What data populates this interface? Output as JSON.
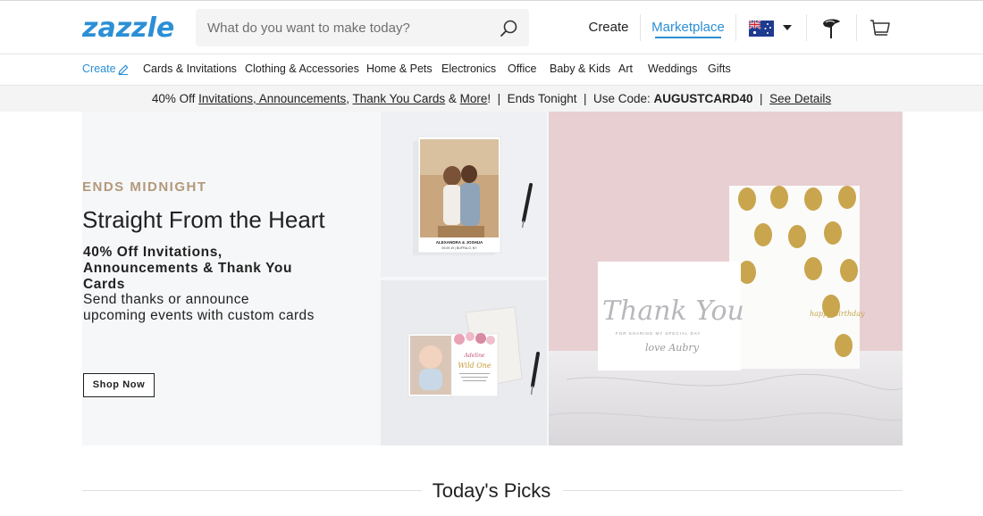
{
  "header": {
    "logo": "zazzle",
    "search": {
      "placeholder": "What do you want to make today?",
      "value": ""
    },
    "create_label": "Create",
    "marketplace_label": "Marketplace",
    "region_flag": "australia-flag-icon",
    "icons": {
      "search": "search-icon",
      "ideas": "ideas-icon",
      "cart": "cart-icon",
      "dropdown": "caret-down-icon"
    }
  },
  "nav": {
    "create_label": "Create",
    "items": [
      "Cards & Invitations",
      "Clothing & Accessories",
      "Home & Pets",
      "Electronics",
      "Office",
      "Baby & Kids",
      "Art",
      "Weddings",
      "Gifts"
    ]
  },
  "promo": {
    "lead": "40% Off ",
    "link1": "Invitations, Announcements",
    "comma": ", ",
    "link2": "Thank You Cards",
    "amp": " & ",
    "link3": "More",
    "rest1": "!  |  Ends Tonight  |  Use Code: ",
    "code": "AUGUSTCARD40",
    "sep": "  |  ",
    "details": "See Details"
  },
  "hero": {
    "eyebrow": "ENDS MIDNIGHT",
    "title": "Straight From the Heart",
    "subtitle": "40% Off Invitations, Announcements & Thank You Cards",
    "description": "Send thanks or announce upcoming events with custom cards",
    "cta": "Shop Now",
    "card_texts": {
      "couple_names": "ALEXANDRA & JOSHUA",
      "couple_date": "09.09.19 | BUFFALO, NY",
      "baby_name": "Adeline",
      "baby_headline": "Wild One",
      "thank_you": "Thank You",
      "thank_you_sub": "FOR SHARING MY SPECIAL DAY",
      "thank_you_sign": "love Aubry",
      "birthday": "happy birthday"
    }
  },
  "section": {
    "title": "Today's Picks"
  },
  "colors": {
    "accent": "#2b8fd6",
    "eyebrow": "#b3997a",
    "gold": "#c9a54e"
  }
}
